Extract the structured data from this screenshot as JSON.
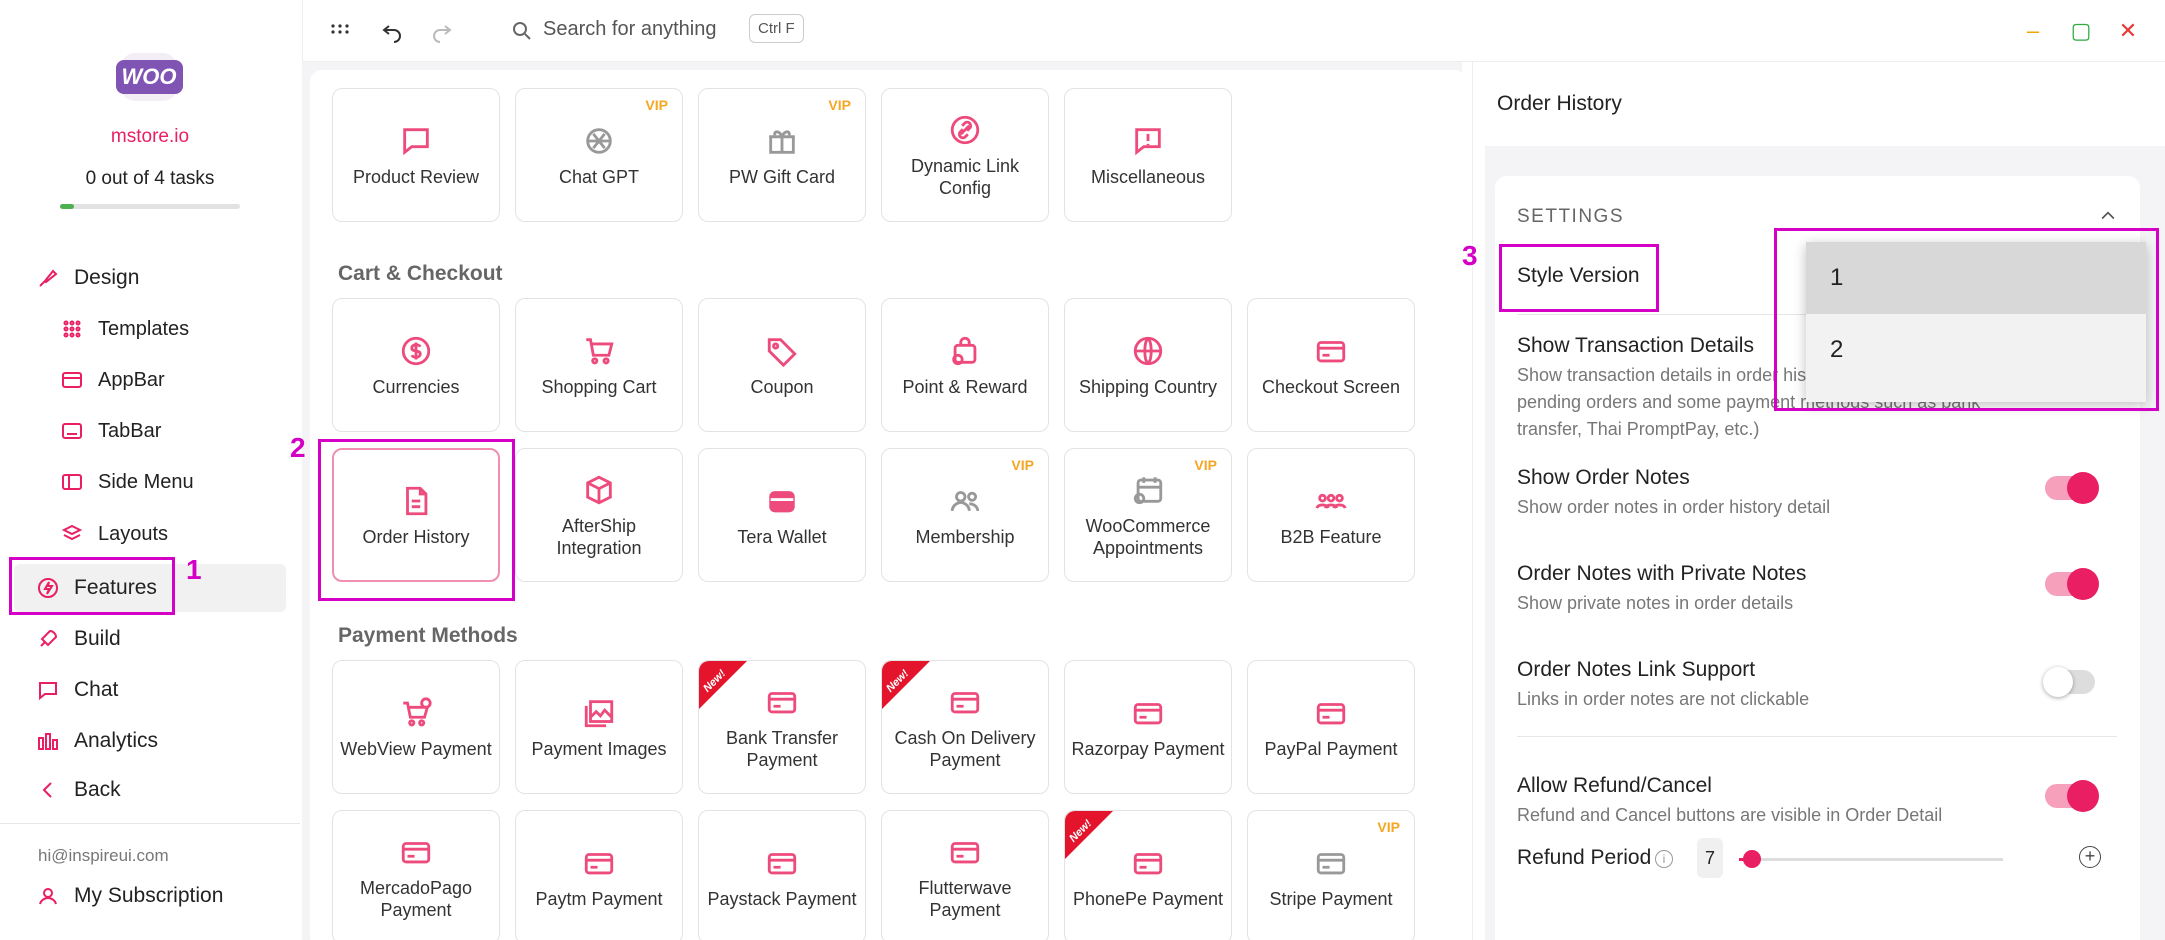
{
  "sidebar": {
    "logo_text": "WOO",
    "store": "mstore.io",
    "tasks": "0 out of 4 tasks",
    "progress": 0.08,
    "items": [
      {
        "label": "Design",
        "icon": "brush-icon"
      },
      {
        "label": "Templates",
        "icon": "grid-dots-icon"
      },
      {
        "label": "AppBar",
        "icon": "appbar-icon"
      },
      {
        "label": "TabBar",
        "icon": "tabbar-icon"
      },
      {
        "label": "Side Menu",
        "icon": "side-menu-icon"
      },
      {
        "label": "Layouts",
        "icon": "layers-icon"
      },
      {
        "label": "Features",
        "icon": "bolt-icon"
      },
      {
        "label": "Build",
        "icon": "rocket-icon"
      },
      {
        "label": "Chat",
        "icon": "chat-icon"
      },
      {
        "label": "Analytics",
        "icon": "bar-chart-icon"
      },
      {
        "label": "Back",
        "icon": "chevron-left-icon"
      }
    ],
    "email": "hi@inspireui.com",
    "subscription": "My Subscription"
  },
  "topbar": {
    "search_placeholder": "Search for anything",
    "shortcut": "Ctrl F"
  },
  "sections": {
    "cart": "Cart & Checkout",
    "payment": "Payment Methods"
  },
  "cards": {
    "row1": [
      "Product Review",
      "Chat GPT",
      "PW Gift Card",
      "Dynamic Link Config",
      "Miscellaneous"
    ],
    "cart1": [
      "Currencies",
      "Shopping Cart",
      "Coupon",
      "Point & Reward",
      "Shipping Country",
      "Checkout Screen"
    ],
    "cart2": [
      "Order History",
      "AfterShip Integration",
      "Tera Wallet",
      "Membership",
      "WooCommerce Appointments",
      "B2B Feature"
    ],
    "pay1": [
      "WebView Payment",
      "Payment Images",
      "Bank Transfer Payment",
      "Cash On Delivery Payment",
      "Razorpay Payment",
      "PayPal Payment"
    ],
    "pay2": [
      "MercadoPago Payment",
      "Paytm Payment",
      "Paystack Payment",
      "Flutterwave Payment",
      "PhonePe Payment",
      "Stripe Payment"
    ]
  },
  "badges": {
    "vip": "VIP",
    "new": "New!"
  },
  "annotations": {
    "n1": "1",
    "n2": "2",
    "n3": "3"
  },
  "panel": {
    "title": "Order History",
    "settings": "SETTINGS",
    "style_version": "Style Version",
    "style_options": [
      "1",
      "2"
    ],
    "show_tx": "Show Transaction Details",
    "show_tx_sub": "Show transaction details in order history details (Only for pending orders and some payment methods such as bank transfer, Thai PromptPay, etc.)",
    "show_notes": "Show Order Notes",
    "show_notes_sub": "Show order notes in order history detail",
    "private_notes": "Order Notes with Private Notes",
    "private_notes_sub": "Show private notes in order details",
    "link_support": "Order Notes Link Support",
    "link_support_sub": "Links in order notes are not clickable",
    "refund": "Allow Refund/Cancel",
    "refund_sub": "Refund and Cancel buttons are visible in Order Detail",
    "refund_period": "Refund Period",
    "refund_value": "7",
    "refund_fraction": 0.05
  },
  "colors": {
    "accent": "#e91e63",
    "annotation": "#d400c6",
    "vip": "#f5a623",
    "ribbon": "#e3142b"
  }
}
